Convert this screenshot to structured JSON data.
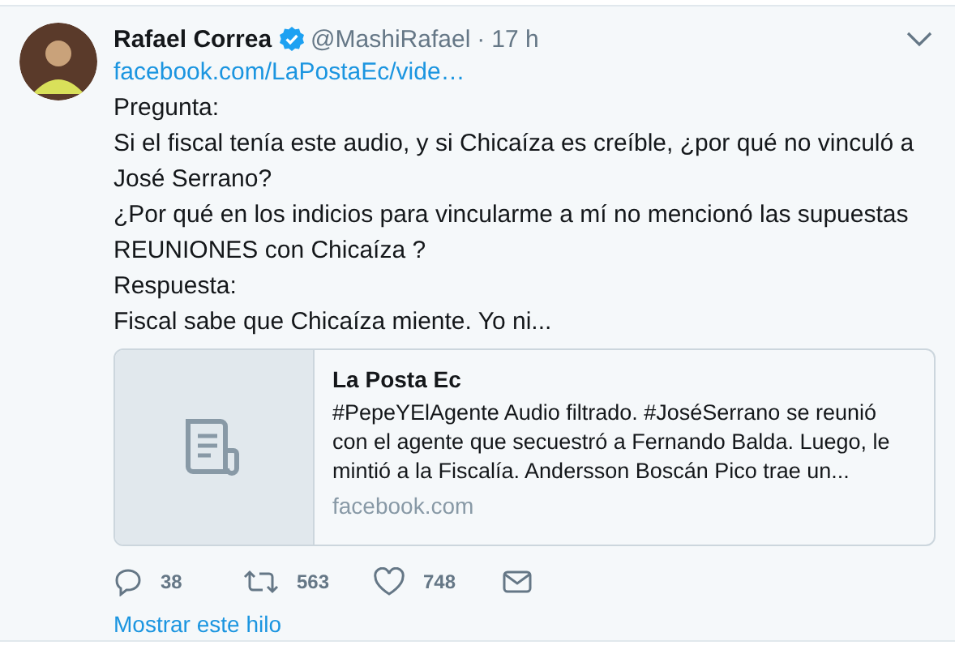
{
  "tweet": {
    "author": "Rafael Correa",
    "verified": true,
    "handle": "@MashiRafael",
    "separator": "·",
    "time": "17 h",
    "link": "facebook.com/LaPostaEc/vide…",
    "body": [
      "Pregunta:",
      "Si el fiscal tenía este audio, y si Chicaíza es creíble, ¿por qué no vinculó a José Serrano?",
      "¿Por qué en los indicios para vincularme a mí no mencionó las supuestas REUNIONES con Chicaíza ?",
      "Respuesta:",
      "Fiscal sabe que Chicaíza miente. Yo ni..."
    ],
    "card": {
      "title": "La Posta Ec",
      "description": "#PepeYElAgente Audio filtrado. #JoséSerrano se reunió con el agente que secuestró a Fernando Balda. Luego, le mintió a la Fiscalía. Andersson Boscán Pico trae un...",
      "domain": "facebook.com"
    },
    "actions": [
      {
        "kind": "reply",
        "count": "38"
      },
      {
        "kind": "retweet",
        "count": "563"
      },
      {
        "kind": "like",
        "count": "748"
      },
      {
        "kind": "message"
      }
    ],
    "thread_link": "Mostrar este hilo"
  }
}
